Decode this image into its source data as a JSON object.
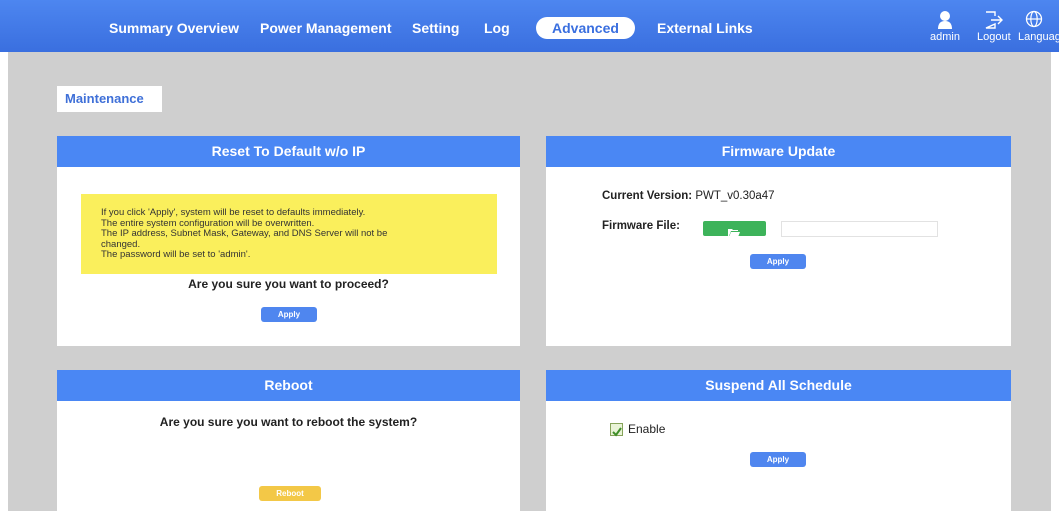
{
  "nav": {
    "items": [
      {
        "label": "Summary Overview"
      },
      {
        "label": "Power Management"
      },
      {
        "label": "Setting"
      },
      {
        "label": "Log"
      },
      {
        "label": "Advanced"
      },
      {
        "label": "External Links"
      }
    ],
    "active": "Advanced",
    "admin_label": "admin",
    "logout_label": "Logout",
    "language_label": "Languag"
  },
  "page": {
    "section_label": "Maintenance"
  },
  "reset_panel": {
    "title": "Reset To Default w/o IP",
    "notice_lines": [
      "If you click 'Apply', system will be reset to defaults immediately.",
      "The entire system configuration will be overwritten.",
      "The IP address, Subnet Mask, Gateway, and DNS Server will not be",
      "changed.",
      "The password will be set to 'admin'."
    ],
    "question": "Are you sure you want to proceed?",
    "apply_label": "Apply"
  },
  "firmware_panel": {
    "title": "Firmware Update",
    "current_version_label": "Current Version:",
    "current_version_value": "PWT_v0.30a47",
    "file_label": "Firmware File:",
    "apply_label": "Apply"
  },
  "reboot_panel": {
    "title": "Reboot",
    "question": "Are you sure you want to reboot the system?",
    "reboot_label": "Reboot"
  },
  "suspend_panel": {
    "title": "Suspend All Schedule",
    "enable_label": "Enable",
    "enable_checked": true,
    "apply_label": "Apply"
  },
  "colors": {
    "nav_blue": "#3a6fdf",
    "panel_header": "#4a87f4",
    "notice_yellow": "#faef5c",
    "browse_green": "#3db35a",
    "reboot_yellow": "#f3c847"
  },
  "icons": [
    "user-icon",
    "logout-icon",
    "globe-icon",
    "folder-open-icon",
    "checkmark-icon"
  ]
}
